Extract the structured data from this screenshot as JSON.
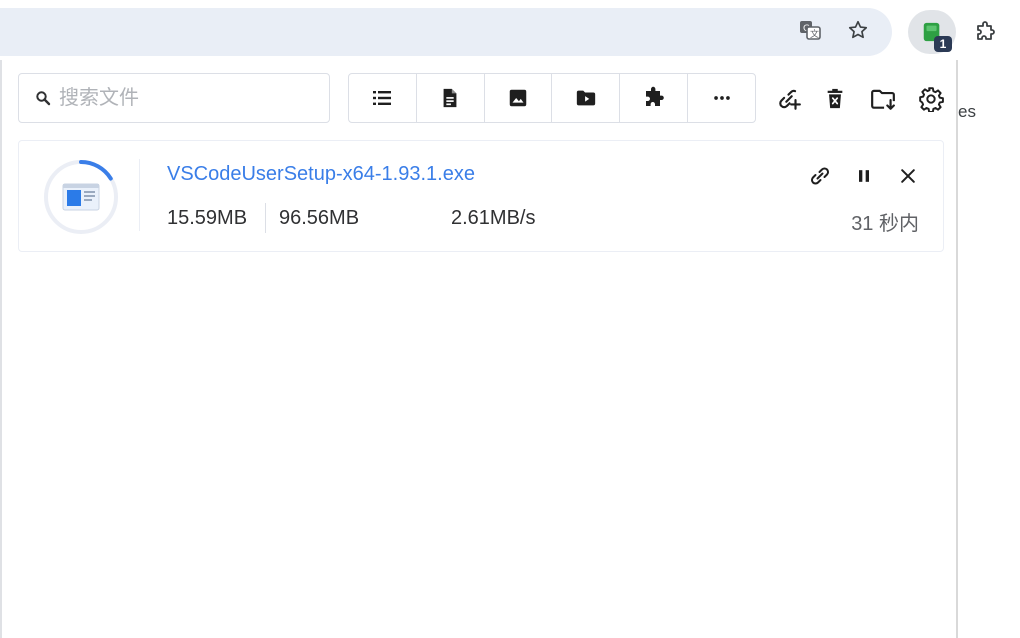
{
  "browser": {
    "icons": [
      "translate-icon",
      "star-icon",
      "extension-icon",
      "puzzle-icon"
    ],
    "extension_badge": "1",
    "background_text": "es"
  },
  "toolbar": {
    "search_placeholder": "搜索文件",
    "filters": [
      "list-icon",
      "document-icon",
      "image-icon",
      "video-icon",
      "extension-icon",
      "more-icon"
    ],
    "actions": [
      "add-link-icon",
      "delete-icon",
      "folder-icon",
      "gear-icon"
    ]
  },
  "download": {
    "file_name": "VSCodeUserSetup-x64-1.93.1.exe",
    "downloaded": "15.59MB",
    "total": "96.56MB",
    "speed": "2.61MB/s",
    "remaining": "31 秒内",
    "progress": 0.1615,
    "accent": "#3a7ee8"
  }
}
